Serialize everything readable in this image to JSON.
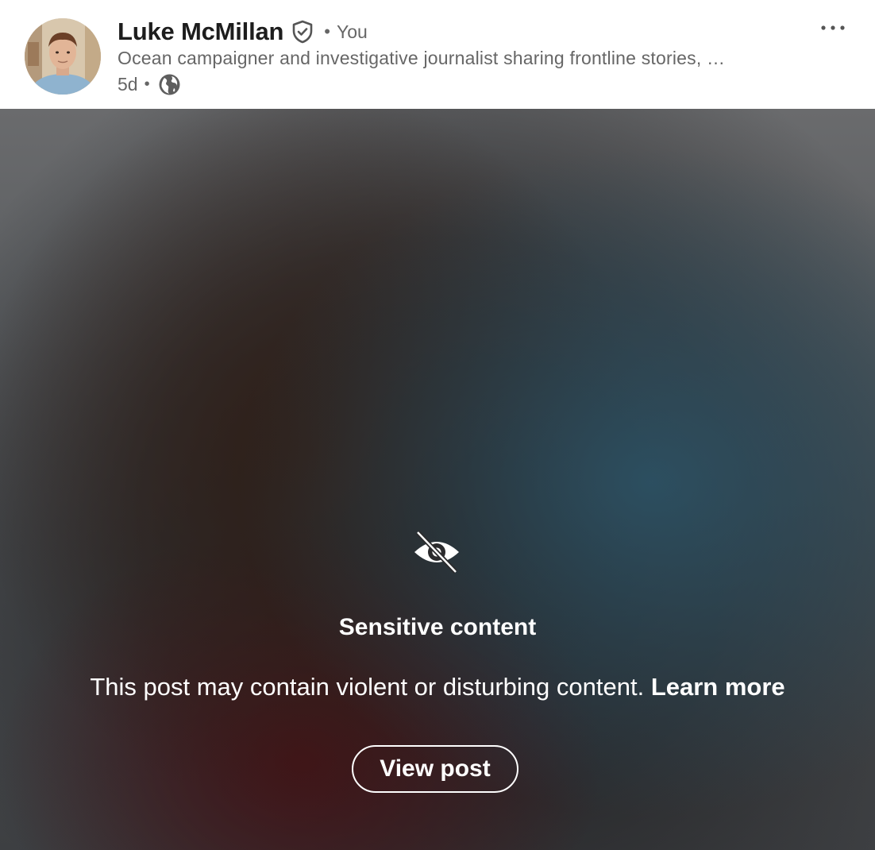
{
  "post": {
    "author": {
      "name": "Luke McMillan",
      "separator": "•",
      "degree": "You",
      "headline": "Ocean campaigner and investigative journalist sharing frontline stories, …",
      "verified_icon": "verified-shield-icon",
      "avatar": "avatar-photo"
    },
    "meta": {
      "age": "5d",
      "separator": "•",
      "visibility_icon": "globe-icon"
    },
    "more_menu_icon": "more-horizontal-icon",
    "sensitive": {
      "icon": "eye-off-icon",
      "title": "Sensitive content",
      "description": "This post may contain violent or disturbing content.",
      "learn_more": "Learn more",
      "view_button": "View post"
    }
  },
  "colors": {
    "text_primary": "#1d1d1d",
    "text_secondary": "#666666",
    "overlay_text": "#ffffff"
  }
}
